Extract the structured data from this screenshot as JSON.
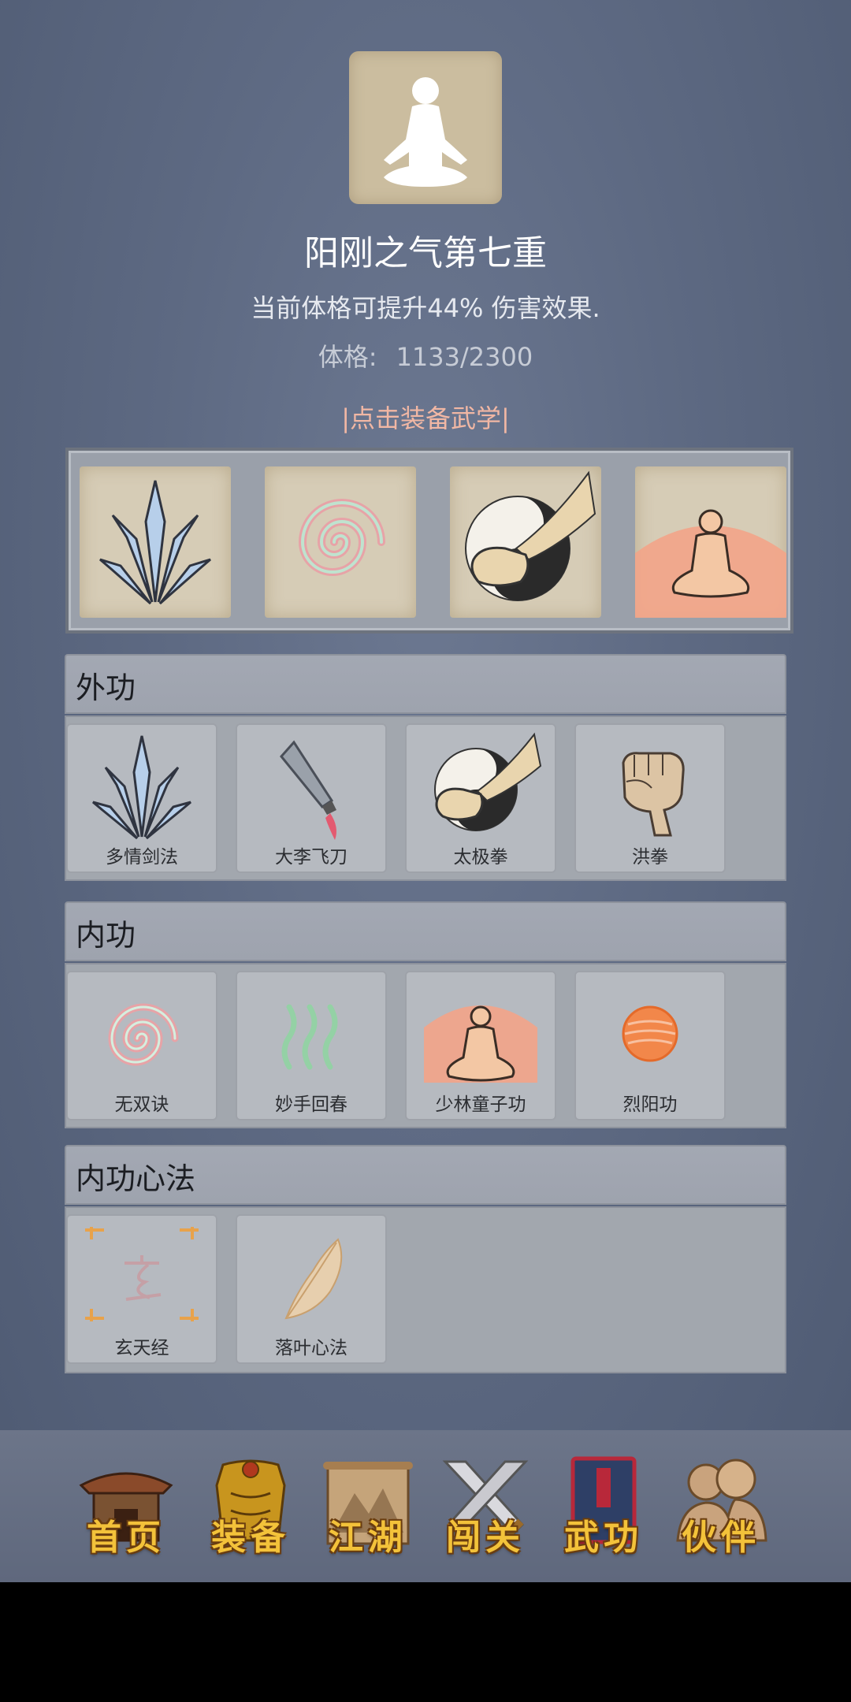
{
  "profile": {
    "title": "阳刚之气第七重",
    "description": "当前体格可提升44% 伤害效果.",
    "stat_label": "体格:",
    "stat_value": "1133/2300",
    "equip_link": "|点击装备武学|"
  },
  "equipped_slots": [
    {
      "icon": "sword-fan-icon"
    },
    {
      "icon": "spiral-icon"
    },
    {
      "icon": "taiji-fist-icon"
    },
    {
      "icon": "meditating-monk-icon"
    }
  ],
  "sections": [
    {
      "title": "外功",
      "skills": [
        {
          "name": "多情剑法",
          "icon": "sword-fan-icon"
        },
        {
          "name": "大李飞刀",
          "icon": "flying-knife-icon"
        },
        {
          "name": "太极拳",
          "icon": "taiji-fist-icon"
        },
        {
          "name": "洪拳",
          "icon": "fist-icon"
        }
      ]
    },
    {
      "title": "内功",
      "skills": [
        {
          "name": "无双诀",
          "icon": "spiral-icon"
        },
        {
          "name": "妙手回春",
          "icon": "healing-waves-icon"
        },
        {
          "name": "少林童子功",
          "icon": "meditating-monk-icon"
        },
        {
          "name": "烈阳功",
          "icon": "sun-orb-icon"
        }
      ]
    },
    {
      "title": "内功心法",
      "skills": [
        {
          "name": "玄天经",
          "icon": "xuan-character-icon"
        },
        {
          "name": "落叶心法",
          "icon": "leaf-icon"
        }
      ]
    }
  ],
  "nav": [
    {
      "label": "首页",
      "icon": "house-icon"
    },
    {
      "label": "装备",
      "icon": "armor-icon"
    },
    {
      "label": "江湖",
      "icon": "scroll-mountain-icon"
    },
    {
      "label": "闯关",
      "icon": "crossed-swords-icon"
    },
    {
      "label": "武功",
      "icon": "book-icon"
    },
    {
      "label": "伙伴",
      "icon": "companions-icon"
    }
  ],
  "colors": {
    "background": "#5d6982",
    "equip_link": "#f1b7a4",
    "nav_label": "#f3c23a"
  }
}
